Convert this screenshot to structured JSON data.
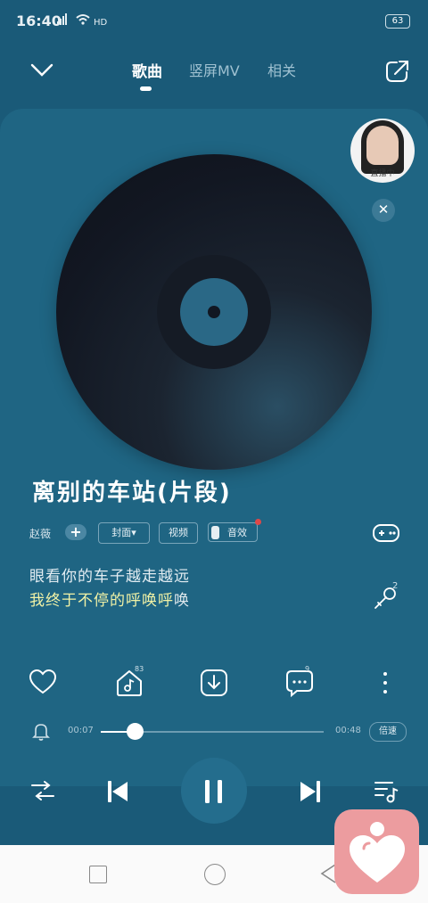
{
  "status_bar": {
    "time": "16:40",
    "signal": "⁴⁶ᴵ",
    "wifi": "HD",
    "battery": "63"
  },
  "nav": {
    "tabs": [
      "歌曲",
      "竖屏MV",
      "相关"
    ]
  },
  "live": {
    "label": "直播中"
  },
  "song": {
    "title": "离别的车站(片段)",
    "artist": "赵薇",
    "tags": [
      "封面▾",
      "视频",
      "音效"
    ]
  },
  "lyrics": {
    "line1": "眼看你的车子越走越远",
    "line2_highlight": "我终于不停的呼唤呼",
    "line2_rest": "唤"
  },
  "actions": {
    "share_count": "83",
    "comment_count": "9",
    "karaoke_count": "2"
  },
  "progress": {
    "current": "00:07",
    "total": "00:48",
    "speed": "倍速",
    "fraction": 0.15
  }
}
